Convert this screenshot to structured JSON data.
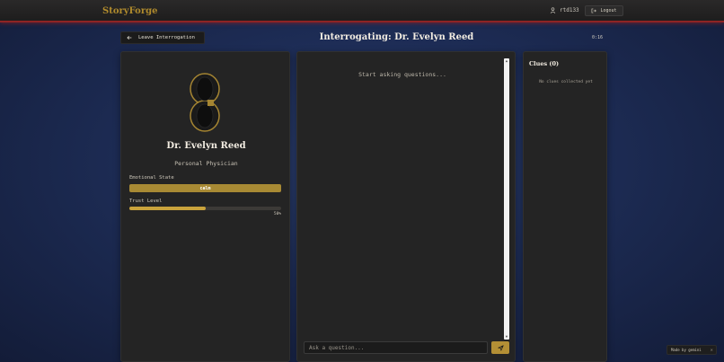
{
  "app": {
    "brand": "StoryForge"
  },
  "header": {
    "username": "rtd133",
    "logout_label": "Logout",
    "user_icon": "user-icon",
    "logout_icon": "logout-icon"
  },
  "page": {
    "leave_label": "Leave Interrogation",
    "title": "Interrogating: Dr. Evelyn Reed",
    "timer": "0:16"
  },
  "suspect": {
    "name": "Dr. Evelyn Reed",
    "role": "Personal Physician",
    "emotional_state_label": "Emotional State",
    "emotional_state": "calm",
    "trust_label": "Trust Level",
    "trust_percent": 50,
    "trust_text": "50%"
  },
  "chat": {
    "empty_text": "Start asking questions...",
    "input_placeholder": "Ask a question...",
    "send_icon": "send-icon"
  },
  "clues": {
    "title": "Clues (0)",
    "empty_text": "No clues collected yet"
  },
  "footer": {
    "made_with": "Made by gemini",
    "close": "✕"
  },
  "colors": {
    "accent": "#b38f35",
    "border_red": "#8e2424",
    "panel": "#242424"
  }
}
